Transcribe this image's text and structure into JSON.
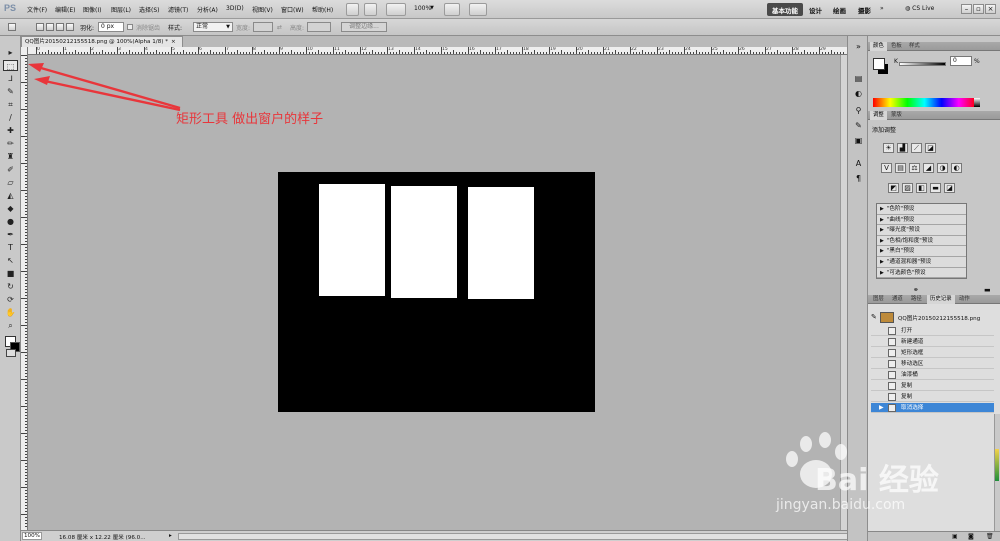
{
  "app": {
    "logo": "PS"
  },
  "menus": [
    "文件(F)",
    "编辑(E)",
    "图像(I)",
    "图层(L)",
    "选择(S)",
    "滤镜(T)",
    "分析(A)",
    "3D(D)",
    "视图(V)",
    "窗口(W)",
    "帮助(H)"
  ],
  "appbar": {
    "zoom": "100%"
  },
  "workspaces": [
    "基本功能",
    "设计",
    "绘画",
    "摄影"
  ],
  "cslive": "CS Live",
  "options": {
    "feather_label": "羽化:",
    "feather_value": "0 px",
    "antialias_label": "消除锯齿",
    "style_label": "样式:",
    "style_value": "正常",
    "width_label": "宽度:",
    "height_label": "高度:",
    "refine_label": "调整边缘..."
  },
  "document": {
    "tab_title": "QQ图片20150212155518.png @ 100%(Alpha 1/8) *",
    "tab_close": "×",
    "status_zoom": "100%",
    "status_size": "16.08 厘米 x 12.22 厘米 (96.0..."
  },
  "ruler_numbers": [
    "0",
    "1",
    "2",
    "3",
    "4",
    "5",
    "6",
    "7",
    "8",
    "9",
    "10",
    "11",
    "12",
    "13",
    "14",
    "15",
    "16",
    "17",
    "18",
    "19",
    "20",
    "21",
    "22",
    "23",
    "24",
    "25",
    "26",
    "27",
    "28",
    "29",
    "30"
  ],
  "annotation": {
    "text": "矩形工具   做出窗户的样子",
    "color": "#e8363b"
  },
  "canvas_data": {
    "background": "#000000",
    "window_panes": [
      {
        "name": "pane-1"
      },
      {
        "name": "pane-2"
      },
      {
        "name": "pane-3"
      }
    ]
  },
  "panels": {
    "color_tabs": [
      "颜色",
      "色板",
      "样式"
    ],
    "k_label": "K",
    "k_value": "0",
    "k_unit": "%",
    "adjust_tabs": [
      "调整",
      "蒙版"
    ],
    "adjust_title": "添加调整",
    "adjust_icons_row1": [
      "☀",
      "▟",
      "⟋",
      "◪"
    ],
    "adjust_icons_row2": [
      "V",
      "▤",
      "⚖",
      "◢",
      "◑",
      "◐"
    ],
    "adjust_icons_row3": [
      "◩",
      "▨",
      "◧",
      "▬",
      "◪"
    ],
    "presets": [
      "\"色阶\"预设",
      "\"曲线\"预设",
      "\"曝光度\"预设",
      "\"色相/饱和度\"预设",
      "\"黑白\"预设",
      "\"通道混和器\"预设",
      "\"可选颜色\"预设"
    ],
    "history_tabs": [
      "图层",
      "通道",
      "路径",
      "历史记录",
      "动作"
    ],
    "snapshot_label": "QQ图片20150212155518.png",
    "history": [
      "打开",
      "新建通道",
      "矩形选框",
      "移动选区",
      "油漆桶",
      "复制",
      "复制",
      "取消选择"
    ],
    "selected_history_index": 7
  },
  "watermark": {
    "brand": "Bai 经验",
    "url": "jingyan.baidu.com"
  }
}
